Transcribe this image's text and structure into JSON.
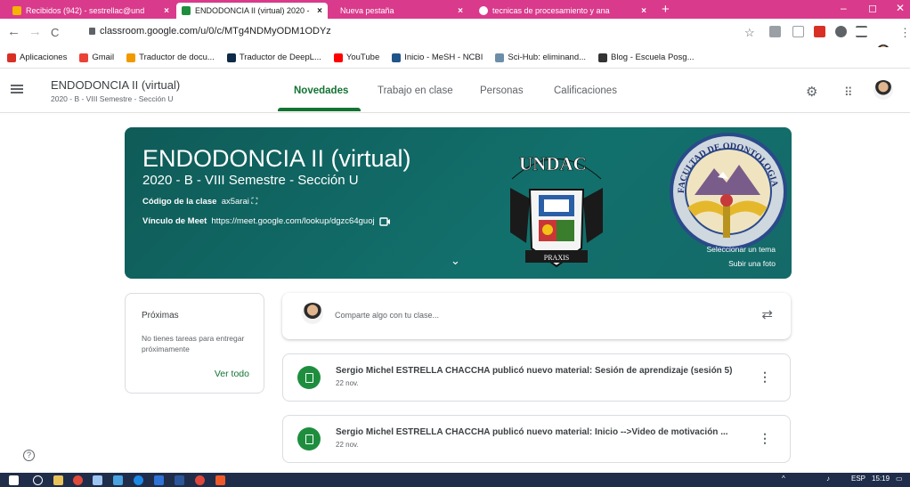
{
  "browser": {
    "tabs": [
      {
        "title": "Recibidos (942) - sestrellac@und",
        "close": "×"
      },
      {
        "title": "ENDODONCIA II (virtual) 2020 - ",
        "close": "×"
      },
      {
        "title": "Nueva pestaña",
        "close": "×"
      },
      {
        "title": "tecnicas de procesamiento y ana",
        "close": "×"
      }
    ],
    "new_tab": "+",
    "window": {
      "minimize": "–",
      "maximize": "◻",
      "close": "✕"
    },
    "nav": {
      "back": "←",
      "forward": "→",
      "reload": "C"
    },
    "url": "classroom.google.com/u/0/c/MTg4NDMyODM1ODYz",
    "star": "☆",
    "menu": "⋮"
  },
  "bookmarks": [
    {
      "label": "Aplicaciones",
      "color": "#d93025"
    },
    {
      "label": "Gmail",
      "color": "#ea4335"
    },
    {
      "label": "Traductor de docu...",
      "color": "#f29900"
    },
    {
      "label": "Traductor de DeepL...",
      "color": "#0f2b46"
    },
    {
      "label": "YouTube",
      "color": "#ff0000"
    },
    {
      "label": "Inicio - MeSH - NCBI",
      "color": "#20558a"
    },
    {
      "label": "Sci-Hub: eliminand...",
      "color": "#6d8ea9"
    },
    {
      "label": "Blog - Escuela Posg...",
      "color": "#333333"
    }
  ],
  "classroom": {
    "class_name": "ENDODONCIA II (virtual)",
    "class_section": "2020 - B - VIII Semestre - Sección U",
    "tabs": [
      "Novedades",
      "Trabajo en clase",
      "Personas",
      "Calificaciones"
    ],
    "active_tab": "Novedades"
  },
  "banner": {
    "title": "ENDODONCIA II (virtual)",
    "subtitle": "2020 - B - VIII Semestre - Sección U",
    "code_label": "Código de la clase",
    "code_value": "ax5arai",
    "meet_label": "Vínculo de Meet",
    "meet_link": "https://meet.google.com/lookup/dgzc64guoj",
    "select_theme": "Seleccionar un tema",
    "upload_photo": "Subir una foto",
    "crest_text": "UNDAC",
    "seal_text": "FACULTAD DE ODONTOLOGIA",
    "color": "#12706c"
  },
  "upcoming": {
    "title": "Próximas",
    "empty_message": "No tienes tareas para entregar próximamente",
    "view_all": "Ver todo"
  },
  "stream": {
    "composer_placeholder": "Comparte algo con tu clase...",
    "posts": [
      {
        "title": "Sergio Michel ESTRELLA CHACCHA publicó nuevo material: Sesión de aprendizaje (sesión 5)",
        "date": "22 nov."
      },
      {
        "title": "Sergio Michel ESTRELLA CHACCHA publicó nuevo material: Inicio -->Video de motivación ...",
        "date": "22 nov."
      }
    ]
  },
  "taskbar": {
    "language": "ESP",
    "time": "15:19"
  }
}
